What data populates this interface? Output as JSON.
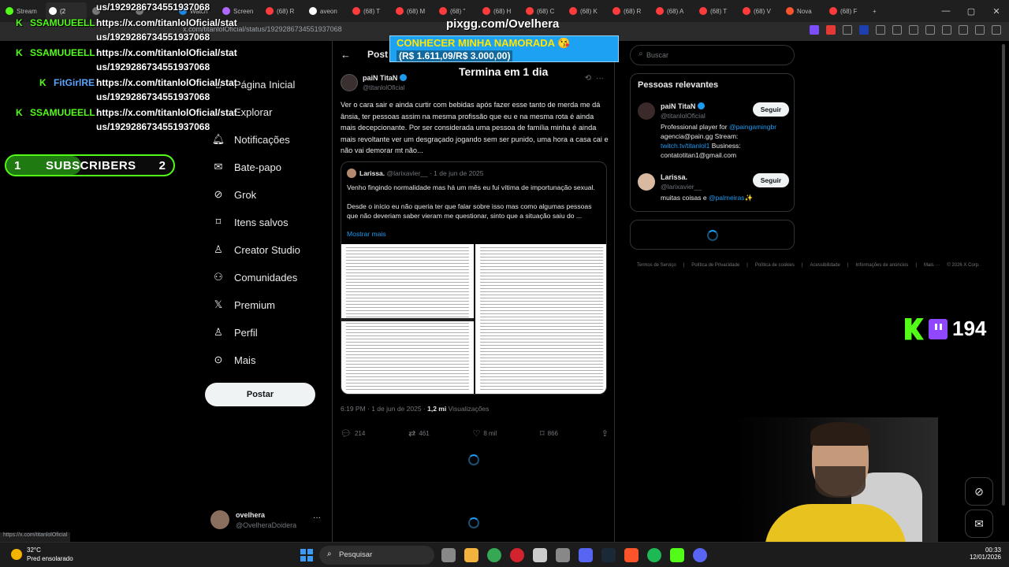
{
  "browser": {
    "tabs": [
      {
        "label": "Stream",
        "color": "#53fc18"
      },
      {
        "label": "(2",
        "color": "#ffffff"
      },
      {
        "label": "",
        "color": "#777777"
      },
      {
        "label": "",
        "color": "#777777"
      },
      {
        "label": "Watch",
        "color": "#1e88e5"
      },
      {
        "label": "Screen",
        "color": "#b069ff"
      },
      {
        "label": "(68) R",
        "color": "#ff3b3b"
      },
      {
        "label": "aveon",
        "color": "#ffffff"
      },
      {
        "label": "(68) T",
        "color": "#ff3b3b"
      },
      {
        "label": "(68) M",
        "color": "#ff3b3b"
      },
      {
        "label": "(68) \"",
        "color": "#ff3b3b"
      },
      {
        "label": "(68) H",
        "color": "#ff3b3b"
      },
      {
        "label": "(68) C",
        "color": "#ff3b3b"
      },
      {
        "label": "(68) K",
        "color": "#ff3b3b"
      },
      {
        "label": "(68) R",
        "color": "#ff3b3b"
      },
      {
        "label": "(68) A",
        "color": "#ff3b3b"
      },
      {
        "label": "(68) T",
        "color": "#ff3b3b"
      },
      {
        "label": "(68) V",
        "color": "#ff3b3b"
      },
      {
        "label": "Nova",
        "color": "#fb542b"
      },
      {
        "label": "(68) F",
        "color": "#ff3b3b"
      }
    ],
    "new_tab": "+",
    "url": "x.com/titanlolOficial/status/1929286734551937068",
    "status_url": "https://x.com/titanlolOficial"
  },
  "stream_overlay": {
    "chat": [
      {
        "user": "SSAMUUEELL",
        "text": "https://x.com/titanlolOficial/stat",
        "cont": "us/1929286734551937068"
      },
      {
        "user": "SSAMUUEELL",
        "text": "https://x.com/titanlolOficial/stat",
        "cont": "us/1929286734551937068"
      },
      {
        "user": "FitGirlRE",
        "text": "https://x.com/titanlolOficial/stat",
        "cont": "us/1929286734551937068"
      },
      {
        "user": "SSAMUUEELL",
        "text": "https://x.com/titanlolOficial/stat",
        "cont": "us/1929286734551937068"
      }
    ],
    "chat_top_partial": "us/1929286734551937068",
    "subs": {
      "start": "1",
      "label": "SUBSCRIBERS",
      "end": "2",
      "progress": 0.45
    },
    "pix": {
      "url": "pixgg.com/Ovelhera",
      "line1": "CONHECER MINHA NAMORADA 😘",
      "line2": "(R$ 1.611,09/R$ 3.000,00)",
      "timer": "Termina em 1 dia"
    },
    "viewer_count": "194"
  },
  "sidebar": {
    "items": [
      {
        "label": "Página Inicial",
        "icon": "home-icon",
        "glyph": "⌂"
      },
      {
        "label": "Explorar",
        "icon": "search-icon",
        "glyph": "⌕"
      },
      {
        "label": "Notificações",
        "icon": "bell-icon",
        "glyph": "🔔︎"
      },
      {
        "label": "Bate-papo",
        "icon": "mail-icon",
        "glyph": "✉"
      },
      {
        "label": "Grok",
        "icon": "grok-icon",
        "glyph": "⊘"
      },
      {
        "label": "Itens salvos",
        "icon": "bookmark-icon",
        "glyph": "⌑"
      },
      {
        "label": "Creator Studio",
        "icon": "creator-icon",
        "glyph": "♙"
      },
      {
        "label": "Comunidades",
        "icon": "communities-icon",
        "glyph": "⚇"
      },
      {
        "label": "Premium",
        "icon": "x-logo-icon",
        "glyph": "𝕏"
      },
      {
        "label": "Perfil",
        "icon": "profile-icon",
        "glyph": "♙"
      },
      {
        "label": "Mais",
        "icon": "more-icon",
        "glyph": "⊙"
      }
    ],
    "post_button": "Postar",
    "account": {
      "name": "ovelhera",
      "handle": "@OvelheraDoidera",
      "more": "···"
    }
  },
  "post": {
    "header": "Post",
    "back": "←",
    "author": {
      "name": "paiN TitaN",
      "handle": "@titanlolOficial"
    },
    "text": "Ver o cara sair e ainda curtir com bebidas após fazer esse tanto de merda me dá ânsia, ter pessoas assim na mesma profissão que eu e na mesma rota é ainda mais decepcionante. Por ser considerada uma pessoa de família minha é ainda mais revoltante ver um desgraçado jogando sem ser punido, uma hora a casa cai e não vai demorar mt não...",
    "quote": {
      "name": "Larissa.",
      "handle": "@larixavier__",
      "date": "· 1 de jun de 2025",
      "text": "Venho fingindo normalidade mas há um mês eu fui vítima de importunação sexual.\n\nDesde o início eu não queria ter que falar sobre isso mas como algumas pessoas que não deveriam saber vieram me questionar, sinto que a situação saiu do ...",
      "more": "Mostrar mais"
    },
    "meta_time": "6:19 PM · 1 de jun de 2025 · ",
    "views_count": "1,2 mi",
    "views_label": " Visualizações",
    "actions": {
      "replies": "214",
      "reposts": "461",
      "likes": "8 mil",
      "bookmarks": "866"
    }
  },
  "right": {
    "search_placeholder": "Buscar",
    "relevant_title": "Pessoas relevantes",
    "people": [
      {
        "name": "paiN TitaN",
        "handle": "@titanlolOficial",
        "bio_pre": "Professional player for ",
        "bio_link": "@paingamingbr",
        "bio_mid": " agencia@pain.gg Stream: ",
        "bio_link2": "twitch.tv/titanlol1",
        "bio_post": " Business: contatotitan1@gmail.com",
        "follow": "Seguir"
      },
      {
        "name": "Larissa.",
        "handle": "@larixavier__",
        "bio_pre": "muitas coisas e ",
        "bio_link": "@palmeiras",
        "bio_mid": "✨",
        "bio_link2": "",
        "bio_post": "",
        "follow": "Seguir"
      }
    ],
    "footer": [
      "Termos de Serviço",
      "|",
      "Política de Privacidade",
      "|",
      "Política de cookies",
      "|",
      "Acessibilidade",
      "|",
      "Informações de anúncios",
      "|",
      "Mais ···",
      "© 2026 X Corp."
    ]
  },
  "taskbar": {
    "weather_temp": "32°C",
    "weather_desc": "Pred ensolarado",
    "search_placeholder": "Pesquisar",
    "time": "00:33",
    "date": "12/01/2026",
    "app_colors": [
      "#888888",
      "#f3b33d",
      "#34a853",
      "#d3232f",
      "#cccccc",
      "#888888",
      "#5865f2",
      "#1b2838",
      "#fb542b",
      "#1db954",
      "#53fc18",
      "#5865f2"
    ]
  }
}
